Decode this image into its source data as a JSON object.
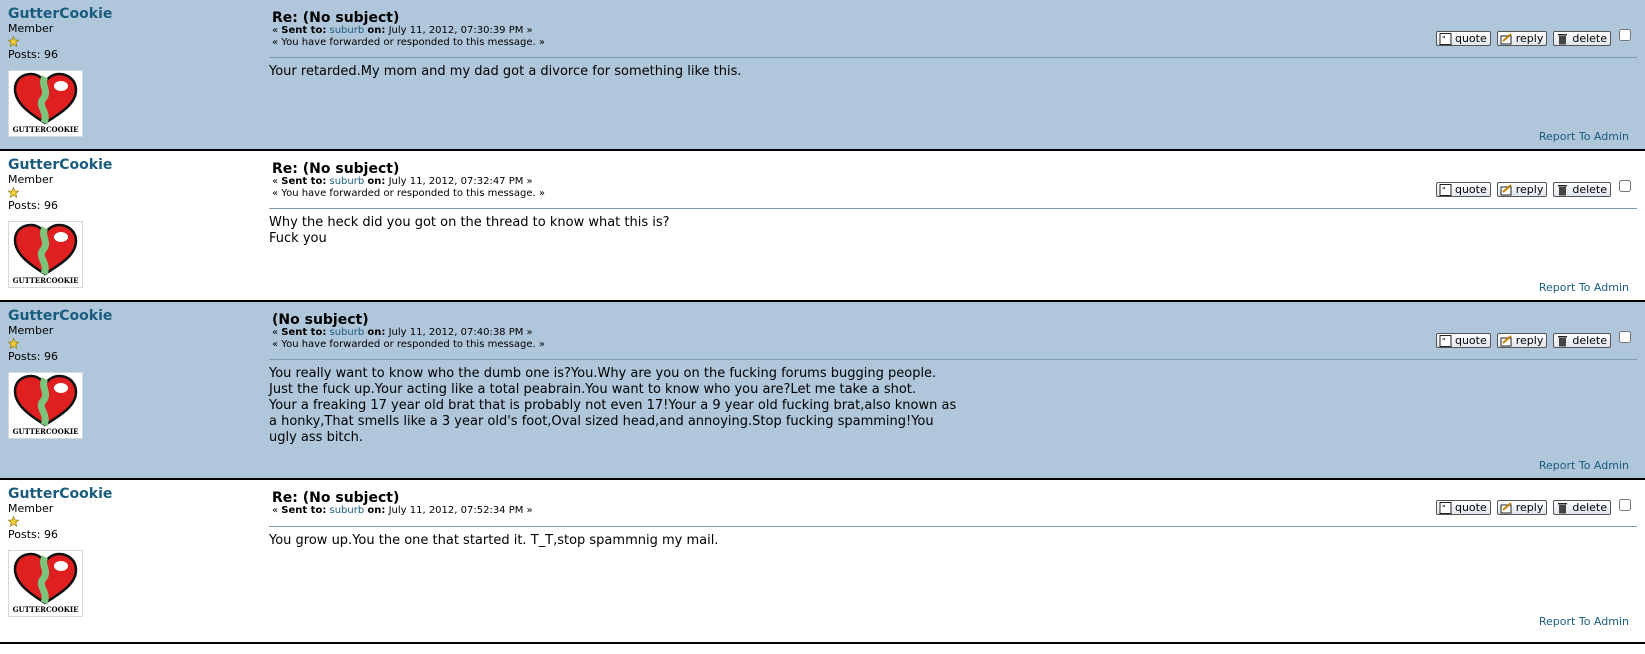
{
  "messages": [
    {
      "author": "GutterCookie",
      "role": "Member",
      "posts": "Posts: 96",
      "avatar_caption": "GUTTERCOOKIE",
      "subject": "Re: (No subject)",
      "sent_prefix": "« ",
      "sent_label": "Sent to:",
      "recipient": "suburb",
      "on_label": "on:",
      "date": "July 11, 2012, 07:30:39 PM »",
      "forward_note": "« You have forwarded or responded to this message. »",
      "body": "Your retarded.My mom and my dad got a divorce for something like this.",
      "quote_label": "quote",
      "reply_label": "reply",
      "delete_label": "delete",
      "report_label": "Report To Admin"
    },
    {
      "author": "GutterCookie",
      "role": "Member",
      "posts": "Posts: 96",
      "avatar_caption": "GUTTERCOOKIE",
      "subject": "Re: (No subject)",
      "sent_prefix": "« ",
      "sent_label": "Sent to:",
      "recipient": "suburb",
      "on_label": "on:",
      "date": "July 11, 2012, 07:32:47 PM »",
      "forward_note": "« You have forwarded or responded to this message. »",
      "body": "Why the heck did you got on the thread to know what this is?\nFuck you",
      "quote_label": "quote",
      "reply_label": "reply",
      "delete_label": "delete",
      "report_label": "Report To Admin"
    },
    {
      "author": "GutterCookie",
      "role": "Member",
      "posts": "Posts: 96",
      "avatar_caption": "GUTTERCOOKIE",
      "subject": "(No subject)",
      "sent_prefix": "« ",
      "sent_label": "Sent to:",
      "recipient": "suburb",
      "on_label": "on:",
      "date": "July 11, 2012, 07:40:38 PM »",
      "forward_note": "« You have forwarded or responded to this message. »",
      "body": "You really want to know who the dumb one is?You.Why are you on the fucking forums bugging people.\nJust the fuck up.Your acting like a total peabrain.You want to know who you are?Let me take a shot.\nYour a freaking 17 year old brat that is probably not even 17!Your a 9 year old fucking brat,also known as\na honky,That smells like a 3 year old's foot,Oval sized head,and annoying.Stop fucking spamming!You\nugly ass bitch.",
      "quote_label": "quote",
      "reply_label": "reply",
      "delete_label": "delete",
      "report_label": "Report To Admin"
    },
    {
      "author": "GutterCookie",
      "role": "Member",
      "posts": "Posts: 96",
      "avatar_caption": "GUTTERCOOKIE",
      "subject": "Re: (No subject)",
      "sent_prefix": "« ",
      "sent_label": "Sent to:",
      "recipient": "suburb",
      "on_label": "on:",
      "date": "July 11, 2012, 07:52:34 PM »",
      "forward_note": "",
      "body": "You grow up.You the one that started it. T_T,stop spammnig my mail.",
      "quote_label": "quote",
      "reply_label": "reply",
      "delete_label": "delete",
      "report_label": "Report To Admin"
    }
  ],
  "colors": {
    "alt_background": "#b0c6da",
    "link": "#1a5c7e"
  },
  "icons": [
    "star-icon",
    "avatar-heart-icon",
    "quote-icon",
    "reply-icon",
    "delete-icon"
  ]
}
